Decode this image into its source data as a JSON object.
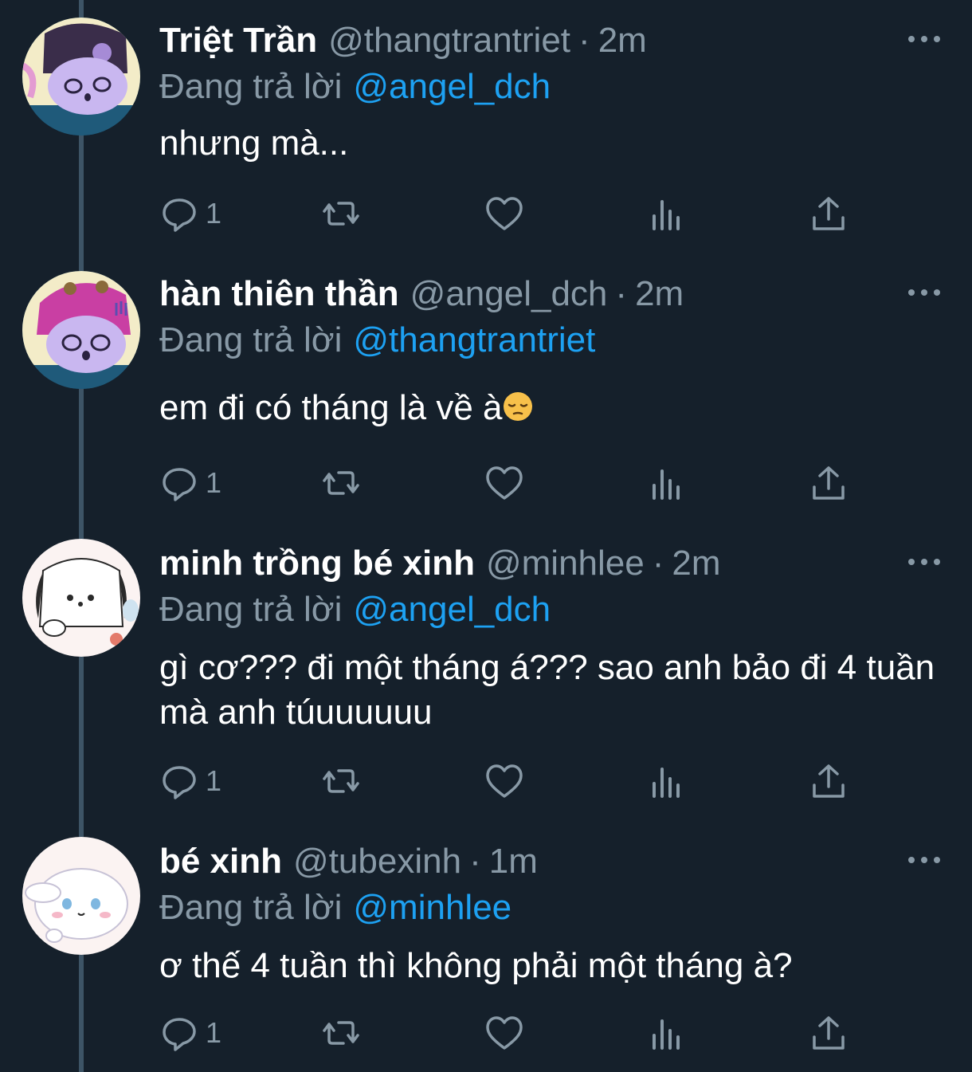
{
  "colors": {
    "background": "#15202b",
    "secondary_text": "#8899a6",
    "link": "#1da1f2",
    "thread_line": "#3d5466"
  },
  "tweets": [
    {
      "display_name": "Triệt Trần",
      "handle": "@thangtrantriet",
      "separator": "·",
      "time": "2m",
      "reply_prefix": "Đang trả lời",
      "reply_to": "@angel_dch",
      "text": "nhưng mà...",
      "reply_count": "1",
      "avatar": "kuromi-avatar"
    },
    {
      "display_name": "hàn thiên thần",
      "handle": "@angel_dch",
      "separator": "·",
      "time": "2m",
      "reply_prefix": "Đang trả lời",
      "reply_to": "@thangtrantriet",
      "text": "em đi có tháng là về à",
      "emoji": "pensive-face-emoji",
      "reply_count": "1",
      "avatar": "my-melody-avatar"
    },
    {
      "display_name": "minh trồng bé xinh",
      "handle": "@minhlee",
      "separator": "·",
      "time": "2m",
      "reply_prefix": "Đang trả lời",
      "reply_to": "@angel_dch",
      "text": "gì cơ??? đi một tháng á??? sao anh bảo đi 4 tuần mà anh túuuuuuu",
      "reply_count": "1",
      "avatar": "pochacco-avatar"
    },
    {
      "display_name": "bé xinh",
      "handle": "@tubexinh",
      "separator": "·",
      "time": "1m",
      "reply_prefix": "Đang trả lời",
      "reply_to": "@minhlee",
      "text": "ơ thế 4 tuần thì không phải một tháng à?",
      "reply_count": "1",
      "avatar": "cinnamoroll-avatar"
    }
  ]
}
